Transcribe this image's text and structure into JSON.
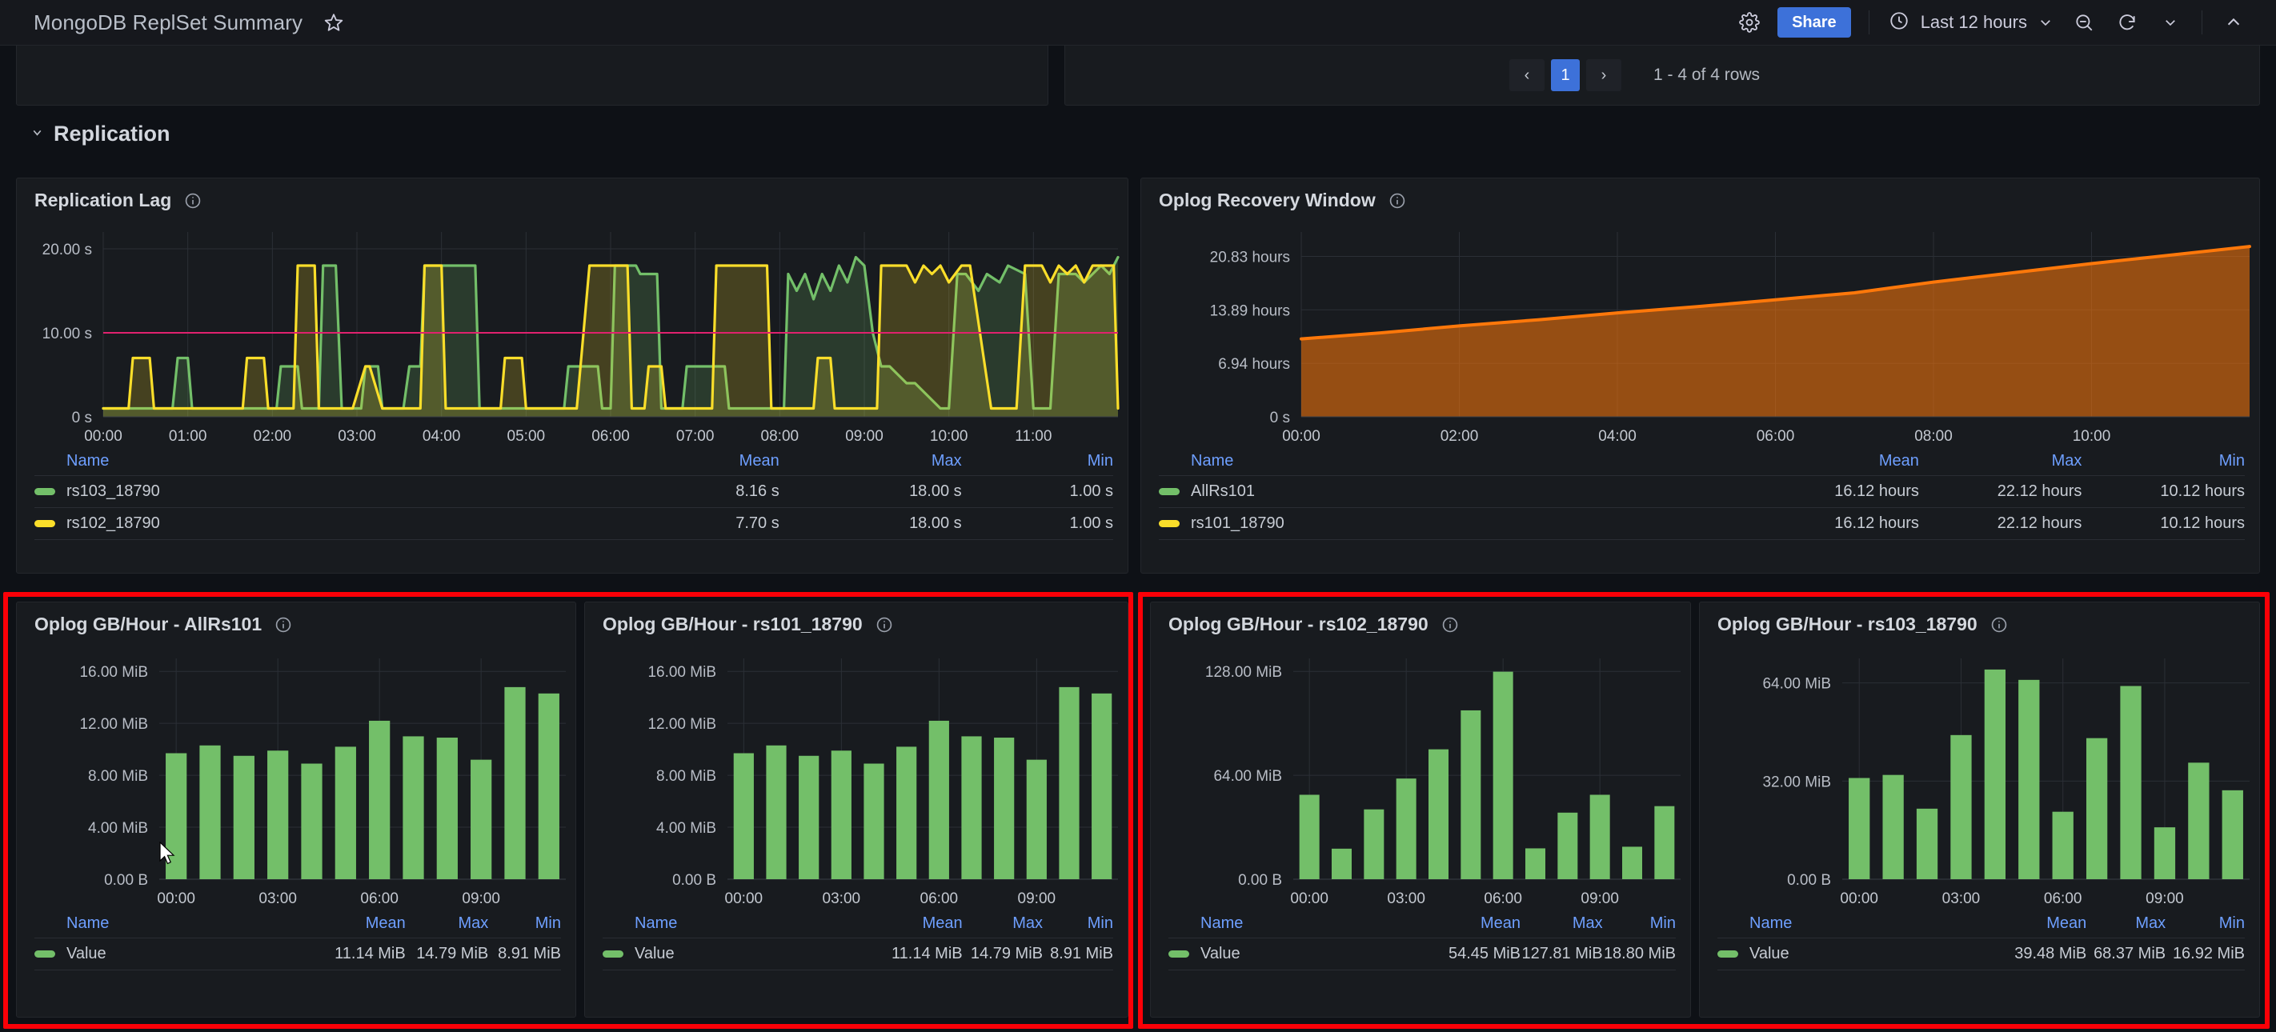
{
  "topbar": {
    "title": "MongoDB ReplSet Summary",
    "star_icon": "star-icon",
    "gear_icon": "gear-icon",
    "share_label": "Share",
    "clock_icon": "clock-icon",
    "time_range": "Last 12 hours",
    "time_chevron": "chevron-down-icon",
    "zoom_out_icon": "zoom-out-icon",
    "refresh_icon": "refresh-icon",
    "refresh_chevron": "chevron-down-icon",
    "collapse_icon": "chevron-up-icon",
    "accent_color": "#3d71d9"
  },
  "pagination": {
    "prev": "‹",
    "page": "1",
    "next": "›",
    "rows_label": "1 - 4 of 4 rows"
  },
  "row": {
    "collapse_icon": "chevron-down-icon",
    "title": "Replication"
  },
  "panels": {
    "replication_lag": {
      "title": "Replication Lag",
      "info_icon": "info-icon",
      "legend_headers": [
        "Name",
        "Mean",
        "Max",
        "Min"
      ],
      "legend_rows": [
        {
          "color": "#73bf69",
          "name": "rs103_18790",
          "mean": "8.16 s",
          "max": "18.00 s",
          "min": "1.00 s"
        },
        {
          "color": "#fade2a",
          "name": "rs102_18790",
          "mean": "7.70 s",
          "max": "18.00 s",
          "min": "1.00 s"
        }
      ]
    },
    "oplog_recovery_window": {
      "title": "Oplog Recovery Window",
      "info_icon": "info-icon",
      "legend_headers": [
        "Name",
        "Mean",
        "Max",
        "Min"
      ],
      "legend_rows": [
        {
          "color": "#73bf69",
          "name": "AllRs101",
          "mean": "16.12 hours",
          "max": "22.12 hours",
          "min": "10.12 hours"
        },
        {
          "color": "#fade2a",
          "name": "rs101_18790",
          "mean": "16.12 hours",
          "max": "22.12 hours",
          "min": "10.12 hours"
        }
      ]
    },
    "oplog_gb_hour_allrs101": {
      "title": "Oplog GB/Hour - AllRs101",
      "info_icon": "info-icon",
      "legend_headers": [
        "Name",
        "Mean",
        "Max",
        "Min"
      ],
      "legend_rows": [
        {
          "color": "#73bf69",
          "name": "Value",
          "mean": "11.14 MiB",
          "max": "14.79 MiB",
          "min": "8.91 MiB"
        }
      ]
    },
    "oplog_gb_hour_rs101": {
      "title": "Oplog GB/Hour - rs101_18790",
      "info_icon": "info-icon",
      "legend_headers": [
        "Name",
        "Mean",
        "Max",
        "Min"
      ],
      "legend_rows": [
        {
          "color": "#73bf69",
          "name": "Value",
          "mean": "11.14 MiB",
          "max": "14.79 MiB",
          "min": "8.91 MiB"
        }
      ]
    },
    "oplog_gb_hour_rs102": {
      "title": "Oplog GB/Hour - rs102_18790",
      "info_icon": "info-icon",
      "legend_headers": [
        "Name",
        "Mean",
        "Max",
        "Min"
      ],
      "legend_rows": [
        {
          "color": "#73bf69",
          "name": "Value",
          "mean": "54.45 MiB",
          "max": "127.81 MiB",
          "min": "18.80 MiB"
        }
      ]
    },
    "oplog_gb_hour_rs103": {
      "title": "Oplog GB/Hour - rs103_18790",
      "info_icon": "info-icon",
      "legend_headers": [
        "Name",
        "Mean",
        "Max",
        "Min"
      ],
      "legend_rows": [
        {
          "color": "#73bf69",
          "name": "Value",
          "mean": "39.48 MiB",
          "max": "68.37 MiB",
          "min": "16.92 MiB"
        }
      ]
    }
  },
  "chart_data": [
    {
      "id": "replication_lag",
      "type": "line",
      "title": "Replication Lag",
      "xlabel": "",
      "ylabel": "",
      "ylim": [
        0,
        22
      ],
      "yticks": [
        0,
        10,
        20
      ],
      "ytick_labels": [
        "0 s",
        "10.00 s",
        "20.00 s"
      ],
      "xticks": [
        "00:00",
        "01:00",
        "02:00",
        "03:00",
        "04:00",
        "05:00",
        "06:00",
        "07:00",
        "08:00",
        "09:00",
        "10:00",
        "11:00"
      ],
      "grid": true,
      "threshold": {
        "value": 10,
        "color": "#e0226e",
        "label": "10.00 s"
      },
      "series": [
        {
          "name": "rs103_18790",
          "color": "#73bf69",
          "fill": true,
          "x": [
            0,
            0.45,
            0.5,
            0.82,
            0.88,
            1.0,
            1.05,
            2.05,
            2.1,
            2.3,
            2.35,
            2.55,
            2.6,
            2.75,
            2.82,
            3.05,
            3.1,
            3.25,
            3.3,
            3.55,
            3.62,
            3.75,
            3.8,
            4.4,
            4.45,
            4.65,
            4.72,
            5.45,
            5.5,
            5.85,
            5.9,
            6.0,
            6.05,
            6.3,
            6.35,
            6.55,
            6.6,
            6.85,
            6.9,
            7.05,
            7.1,
            7.35,
            7.4,
            8.05,
            8.1,
            8.2,
            8.3,
            8.4,
            8.5,
            8.6,
            8.7,
            8.8,
            8.9,
            9.0,
            9.1,
            9.2,
            9.3,
            9.5,
            9.6,
            9.9,
            10.0,
            10.1,
            10.2,
            10.35,
            10.45,
            10.6,
            10.7,
            10.9,
            11.0,
            11.2,
            11.3,
            11.5,
            11.6,
            11.8,
            11.9,
            12.0
          ],
          "y": [
            1,
            1,
            1,
            1,
            7,
            7,
            1,
            1,
            6,
            6,
            1,
            1,
            18,
            18,
            1,
            1,
            6,
            6,
            1,
            1,
            6,
            6,
            18,
            18,
            1,
            1,
            1,
            1,
            6,
            6,
            1,
            1,
            18,
            18,
            17,
            17,
            1,
            1,
            6,
            6,
            6,
            6,
            1,
            1,
            17,
            15,
            17,
            14,
            17,
            15,
            18,
            16,
            19,
            18,
            10,
            6,
            6,
            4,
            4,
            1,
            1,
            17,
            17,
            15,
            17,
            16,
            18,
            17,
            1,
            1,
            17,
            17,
            16,
            18,
            17,
            19
          ]
        },
        {
          "name": "rs102_18790",
          "color": "#fade2a",
          "fill": true,
          "x": [
            0,
            0.3,
            0.35,
            0.55,
            0.6,
            1.65,
            1.7,
            1.9,
            1.95,
            2.25,
            2.3,
            2.5,
            2.55,
            2.9,
            2.95,
            3.1,
            3.15,
            3.3,
            3.35,
            3.75,
            3.8,
            4.0,
            4.05,
            4.7,
            4.75,
            4.95,
            5.0,
            5.55,
            5.6,
            5.75,
            5.8,
            6.2,
            6.25,
            6.4,
            6.45,
            6.6,
            6.65,
            6.8,
            6.85,
            7.2,
            7.25,
            7.85,
            7.9,
            8.4,
            8.45,
            8.6,
            8.65,
            9.15,
            9.2,
            9.45,
            9.5,
            9.6,
            9.7,
            9.8,
            9.9,
            10.0,
            10.15,
            10.25,
            10.5,
            10.6,
            10.8,
            10.9,
            11.0,
            11.1,
            11.2,
            11.3,
            11.4,
            11.5,
            11.6,
            11.7,
            11.85,
            11.95,
            12.0
          ],
          "y": [
            1,
            1,
            7,
            7,
            1,
            1,
            7,
            7,
            1,
            1,
            18,
            18,
            1,
            1,
            1,
            6,
            6,
            1,
            1,
            1,
            18,
            18,
            1,
            1,
            7,
            7,
            1,
            1,
            1,
            18,
            18,
            18,
            1,
            1,
            6,
            6,
            1,
            1,
            1,
            1,
            18,
            18,
            1,
            1,
            7,
            7,
            1,
            1,
            18,
            18,
            18,
            16,
            18,
            17,
            18,
            16,
            18,
            18,
            1,
            1,
            1,
            18,
            18,
            18,
            16,
            18,
            17,
            18,
            16,
            18,
            18,
            18,
            1
          ]
        }
      ]
    },
    {
      "id": "oplog_recovery_window",
      "type": "area",
      "title": "Oplog Recovery Window",
      "xlabel": "",
      "ylabel": "",
      "ylim": [
        0,
        24
      ],
      "yticks": [
        0,
        6.94,
        13.89,
        20.83
      ],
      "ytick_labels": [
        "0 s",
        "6.94 hours",
        "13.89 hours",
        "20.83 hours"
      ],
      "xticks": [
        "00:00",
        "02:00",
        "04:00",
        "06:00",
        "08:00",
        "10:00"
      ],
      "grid": true,
      "series": [
        {
          "name": "AllRs101",
          "color": "#ff780a",
          "fill": true,
          "x": [
            0,
            1,
            2,
            3,
            4,
            5,
            6,
            7,
            8,
            9,
            10,
            11,
            12
          ],
          "y": [
            10.12,
            10.9,
            11.8,
            12.6,
            13.5,
            14.3,
            15.2,
            16.1,
            17.5,
            18.7,
            19.9,
            21.0,
            22.12
          ]
        }
      ]
    },
    {
      "id": "oplog_gb_hour_allrs101",
      "type": "bar",
      "title": "Oplog GB/Hour - AllRs101",
      "xlabel": "",
      "ylabel": "",
      "ylim": [
        0,
        17
      ],
      "yticks": [
        0,
        4,
        8,
        12,
        16
      ],
      "ytick_labels": [
        "0.00 B",
        "4.00 MiB",
        "8.00 MiB",
        "12.00 MiB",
        "16.00 MiB"
      ],
      "categories": [
        "00:00",
        "01:00",
        "02:00",
        "03:00",
        "04:00",
        "05:00",
        "06:00",
        "07:00",
        "08:00",
        "09:00",
        "10:00",
        "11:00"
      ],
      "xticks": [
        "00:00",
        "03:00",
        "06:00",
        "09:00"
      ],
      "xtick_index": [
        0,
        3,
        6,
        9
      ],
      "values": [
        9.7,
        10.3,
        9.5,
        9.9,
        8.9,
        10.2,
        12.2,
        11.0,
        10.9,
        9.2,
        14.79,
        14.3
      ],
      "bar_color": "#73bf69",
      "grid": true
    },
    {
      "id": "oplog_gb_hour_rs101",
      "type": "bar",
      "title": "Oplog GB/Hour - rs101_18790",
      "xlabel": "",
      "ylabel": "",
      "ylim": [
        0,
        17
      ],
      "yticks": [
        0,
        4,
        8,
        12,
        16
      ],
      "ytick_labels": [
        "0.00 B",
        "4.00 MiB",
        "8.00 MiB",
        "12.00 MiB",
        "16.00 MiB"
      ],
      "categories": [
        "00:00",
        "01:00",
        "02:00",
        "03:00",
        "04:00",
        "05:00",
        "06:00",
        "07:00",
        "08:00",
        "09:00",
        "10:00",
        "11:00"
      ],
      "xticks": [
        "00:00",
        "03:00",
        "06:00",
        "09:00"
      ],
      "xtick_index": [
        0,
        3,
        6,
        9
      ],
      "values": [
        9.7,
        10.3,
        9.5,
        9.9,
        8.9,
        10.2,
        12.2,
        11.0,
        10.9,
        9.2,
        14.79,
        14.3
      ],
      "bar_color": "#73bf69",
      "grid": true
    },
    {
      "id": "oplog_gb_hour_rs102",
      "type": "bar",
      "title": "Oplog GB/Hour - rs102_18790",
      "xlabel": "",
      "ylabel": "",
      "ylim": [
        0,
        136
      ],
      "yticks": [
        0,
        64,
        128
      ],
      "ytick_labels": [
        "0.00 B",
        "64.00 MiB",
        "128.00 MiB"
      ],
      "categories": [
        "00:00",
        "01:00",
        "02:00",
        "03:00",
        "04:00",
        "05:00",
        "06:00",
        "07:00",
        "08:00",
        "09:00",
        "10:00",
        "11:00"
      ],
      "xticks": [
        "00:00",
        "03:00",
        "06:00",
        "09:00"
      ],
      "xtick_index": [
        0,
        3,
        6,
        9
      ],
      "values": [
        52,
        18.8,
        43,
        62,
        80,
        104,
        127.81,
        19,
        41,
        52,
        20,
        45
      ],
      "bar_color": "#73bf69",
      "grid": true
    },
    {
      "id": "oplog_gb_hour_rs103",
      "type": "bar",
      "title": "Oplog GB/Hour - rs103_18790",
      "xlabel": "",
      "ylabel": "",
      "ylim": [
        0,
        72
      ],
      "yticks": [
        0,
        32,
        64
      ],
      "ytick_labels": [
        "0.00 B",
        "32.00 MiB",
        "64.00 MiB"
      ],
      "categories": [
        "00:00",
        "01:00",
        "02:00",
        "03:00",
        "04:00",
        "05:00",
        "06:00",
        "07:00",
        "08:00",
        "09:00",
        "10:00",
        "11:00"
      ],
      "xticks": [
        "00:00",
        "03:00",
        "06:00",
        "09:00"
      ],
      "xtick_index": [
        0,
        3,
        6,
        9
      ],
      "values": [
        33,
        34,
        23,
        47,
        68.37,
        65,
        22,
        46,
        63,
        16.92,
        38,
        29
      ],
      "bar_color": "#73bf69",
      "grid": true
    }
  ]
}
